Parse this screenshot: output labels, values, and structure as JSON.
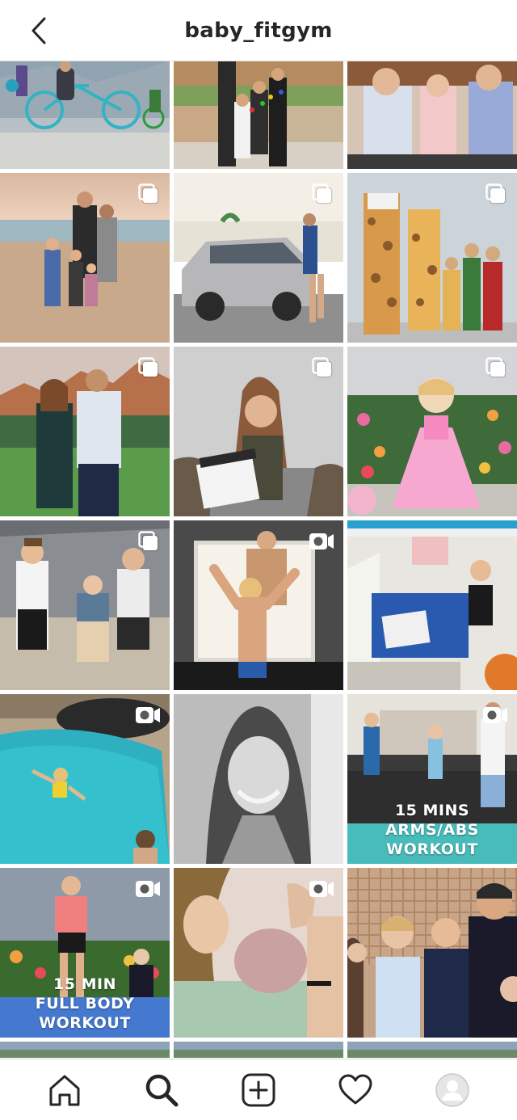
{
  "header": {
    "title": "baby_fitgym",
    "back_icon": "chevron-left-icon"
  },
  "grid": {
    "tiles": [
      {
        "name": "post-family-bicycles",
        "scene": "street",
        "badge": "none",
        "caption": []
      },
      {
        "name": "post-kids-christmas-lights",
        "scene": "yard",
        "badge": "none",
        "caption": []
      },
      {
        "name": "post-kids-covering-eyes",
        "scene": "family",
        "badge": "none",
        "caption": []
      },
      {
        "name": "post-family-beach",
        "scene": "beach",
        "badge": "carousel",
        "caption": []
      },
      {
        "name": "post-woman-with-suv",
        "scene": "suv",
        "badge": "carousel",
        "caption": []
      },
      {
        "name": "post-giraffe-costumes",
        "scene": "costume",
        "badge": "carousel",
        "caption": []
      },
      {
        "name": "post-couple-sedona",
        "scene": "mountain",
        "badge": "carousel",
        "caption": []
      },
      {
        "name": "post-woman-clapperboard",
        "scene": "studio",
        "badge": "carousel",
        "caption": []
      },
      {
        "name": "post-girl-pink-dress",
        "scene": "flowers",
        "badge": "carousel",
        "caption": []
      },
      {
        "name": "post-kids-by-car",
        "scene": "car",
        "badge": "carousel",
        "caption": []
      },
      {
        "name": "post-mom-and-boy-flexing",
        "scene": "doorway",
        "badge": "video",
        "caption": []
      },
      {
        "name": "post-boy-at-desk",
        "scene": "classroom",
        "badge": "none",
        "caption": []
      },
      {
        "name": "post-kids-pool",
        "scene": "pool",
        "badge": "video",
        "caption": []
      },
      {
        "name": "post-woman-portrait-bw",
        "scene": "bw",
        "badge": "none",
        "caption": []
      },
      {
        "name": "post-arms-abs-workout",
        "scene": "livingroom",
        "badge": "video",
        "caption": [
          "15 MINS",
          "ARMS/ABS WORKOUT"
        ]
      },
      {
        "name": "post-full-body-workout",
        "scene": "garden",
        "badge": "video",
        "caption": [
          "15 MIN",
          "FULL BODY WORKOUT"
        ]
      },
      {
        "name": "post-newborn",
        "scene": "newborn",
        "badge": "video",
        "caption": []
      },
      {
        "name": "post-family-portrait",
        "scene": "wall",
        "badge": "none",
        "caption": []
      },
      {
        "name": "post-partial-1",
        "scene": "partial",
        "badge": "none",
        "caption": []
      },
      {
        "name": "post-partial-2",
        "scene": "partial",
        "badge": "none",
        "caption": []
      },
      {
        "name": "post-partial-3",
        "scene": "partial",
        "badge": "none",
        "caption": []
      }
    ]
  },
  "tabbar": {
    "items": [
      {
        "name": "tab-home",
        "icon": "home-icon"
      },
      {
        "name": "tab-search",
        "icon": "search-icon"
      },
      {
        "name": "tab-new-post",
        "icon": "plus-square-icon"
      },
      {
        "name": "tab-activity",
        "icon": "heart-icon"
      },
      {
        "name": "tab-profile",
        "icon": "avatar-icon"
      }
    ]
  },
  "colors": {
    "text": "#262626",
    "border": "#dbdbdb",
    "caption_teal": "#2bb5b5",
    "caption_blue": "#2f6fd6"
  }
}
